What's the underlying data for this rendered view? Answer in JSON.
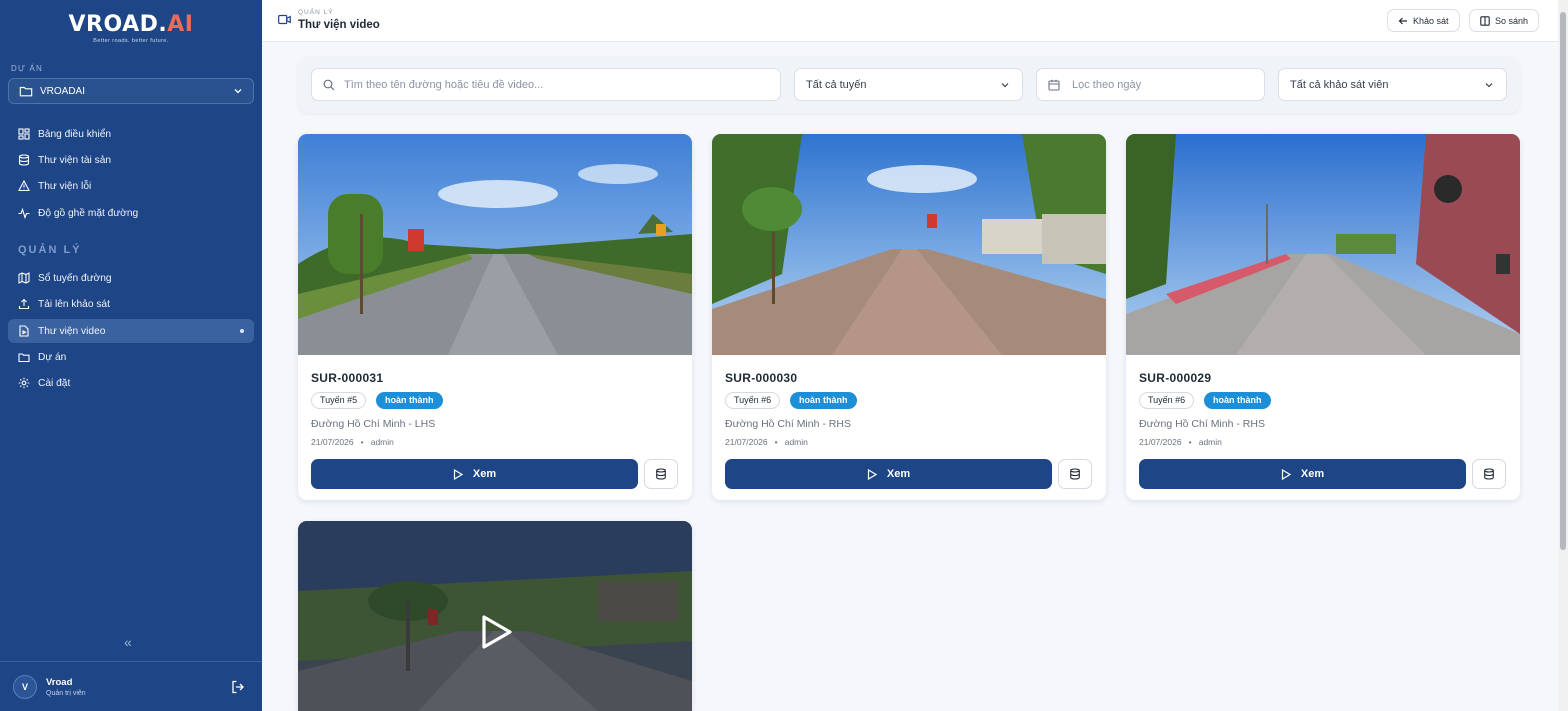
{
  "brand": {
    "name_main": "VROAD.",
    "name_accent": "AI",
    "tagline": "Better roads. better future."
  },
  "sidebar": {
    "project_label": "DỰ ÁN",
    "project_value": "VROADAI",
    "items_top": [
      {
        "label": "Bảng điều khiển",
        "icon": "dashboard-icon"
      },
      {
        "label": "Thư viện tài sản",
        "icon": "database-icon"
      },
      {
        "label": "Thư viện lỗi",
        "icon": "warning-icon"
      },
      {
        "label": "Độ gồ ghề mặt đường",
        "icon": "activity-icon"
      }
    ],
    "section_label": "QUẢN LÝ",
    "items_manage": [
      {
        "label": "Sổ tuyến đường",
        "icon": "map-icon"
      },
      {
        "label": "Tải lên khảo sát",
        "icon": "upload-icon"
      },
      {
        "label": "Thư viện video",
        "icon": "file-video-icon",
        "active": true
      },
      {
        "label": "Dự án",
        "icon": "folder-icon"
      },
      {
        "label": "Cài đặt",
        "icon": "settings-icon"
      }
    ],
    "collapse_glyph": "«",
    "user": {
      "initial": "V",
      "name": "Vroad",
      "role": "Quản trị viên"
    }
  },
  "header": {
    "section": "QUẢN LÝ",
    "title": "Thư viện video",
    "btn_back": "Khảo sát",
    "btn_compare": "So sánh"
  },
  "filters": {
    "search_placeholder": "Tìm theo tên đường hoặc tiêu đề video...",
    "route_value": "Tất cả tuyến",
    "date_placeholder": "Lọc theo ngày",
    "surveyor_value": "Tất cả khảo sát viên"
  },
  "cards": [
    {
      "id": "SUR-000031",
      "route": "Tuyến #5",
      "status": "hoàn thành",
      "road": "Đường Hồ Chí Minh - LHS",
      "date": "21/07/2026",
      "sep": "•",
      "user": "admin",
      "view_label": "Xem"
    },
    {
      "id": "SUR-000030",
      "route": "Tuyến #6",
      "status": "hoàn thành",
      "road": "Đường Hồ Chí Minh - RHS",
      "date": "21/07/2026",
      "sep": "•",
      "user": "admin",
      "view_label": "Xem"
    },
    {
      "id": "SUR-000029",
      "route": "Tuyến #6",
      "status": "hoàn thành",
      "road": "Đường Hồ Chí Minh - RHS",
      "date": "21/07/2026",
      "sep": "•",
      "user": "admin",
      "view_label": "Xem"
    }
  ],
  "colors": {
    "sidebar_bg": "#1e4585",
    "accent": "#1e4585",
    "status": "#1d8fd8",
    "logo_ai": "#e96b5b"
  }
}
